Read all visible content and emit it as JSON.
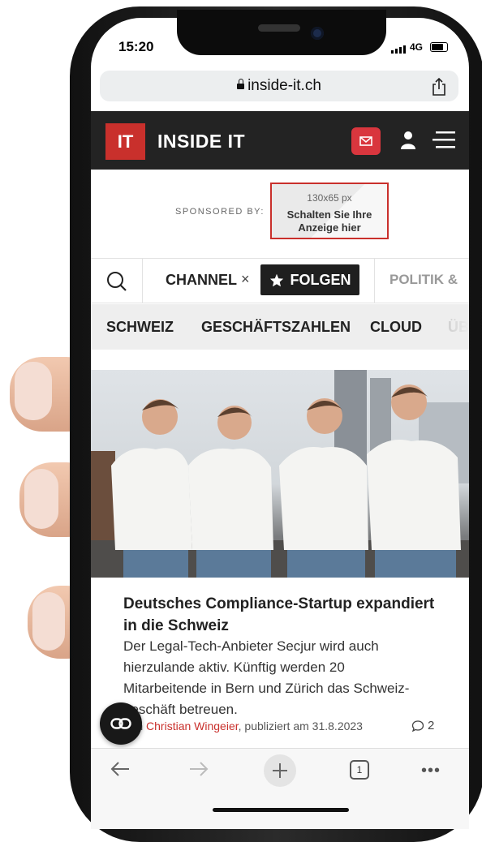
{
  "status_bar": {
    "time": "15:20",
    "network": "4G"
  },
  "browser": {
    "url": "inside-it.ch",
    "tab_count": "1"
  },
  "site": {
    "logo_mark": "IT",
    "logo_text": "INSIDE IT"
  },
  "sponsor": {
    "label": "SPONSORED BY:",
    "ad_size": "130x65 px",
    "ad_line1": "Schalten Sie Ihre",
    "ad_line2": "Anzeige hier"
  },
  "channel_bar": {
    "channel_label": "CHANNEL",
    "close_symbol": "×",
    "follow_label": "FOLGEN",
    "next_channel": "POLITIK &"
  },
  "sub_nav": {
    "items": [
      "SCHWEIZ",
      "GESCHÄFTSZAHLEN",
      "CLOUD",
      "ÜB"
    ]
  },
  "article": {
    "title": "Deutsches Compliance-Startup expandiert in die Schweiz",
    "teaser_lines": [
      "Der Legal-Tech-Anbieter Secjur wird auch",
      "hierzulande aktiv. Künftig werden 20",
      "Mitarbeitende in Bern und Zürich das Schweiz-",
      "geschäft betreuen."
    ],
    "meta_prefix": "Von ",
    "author": "Christian Wingeier",
    "meta_suffix": ", publiziert am 31.8.2023",
    "comment_count": "2"
  },
  "icons": {
    "share": "share-icon",
    "mail": "mail-icon",
    "user": "user-icon",
    "menu": "hamburger-icon",
    "search": "search-icon",
    "star": "star-icon",
    "link": "link-icon",
    "back": "back-arrow-icon",
    "forward": "forward-arrow-icon",
    "more": "more-dots-icon"
  },
  "colors": {
    "brand_red": "#c9302c",
    "header_dark": "#232323",
    "follow_dark": "#1f1f1f"
  }
}
